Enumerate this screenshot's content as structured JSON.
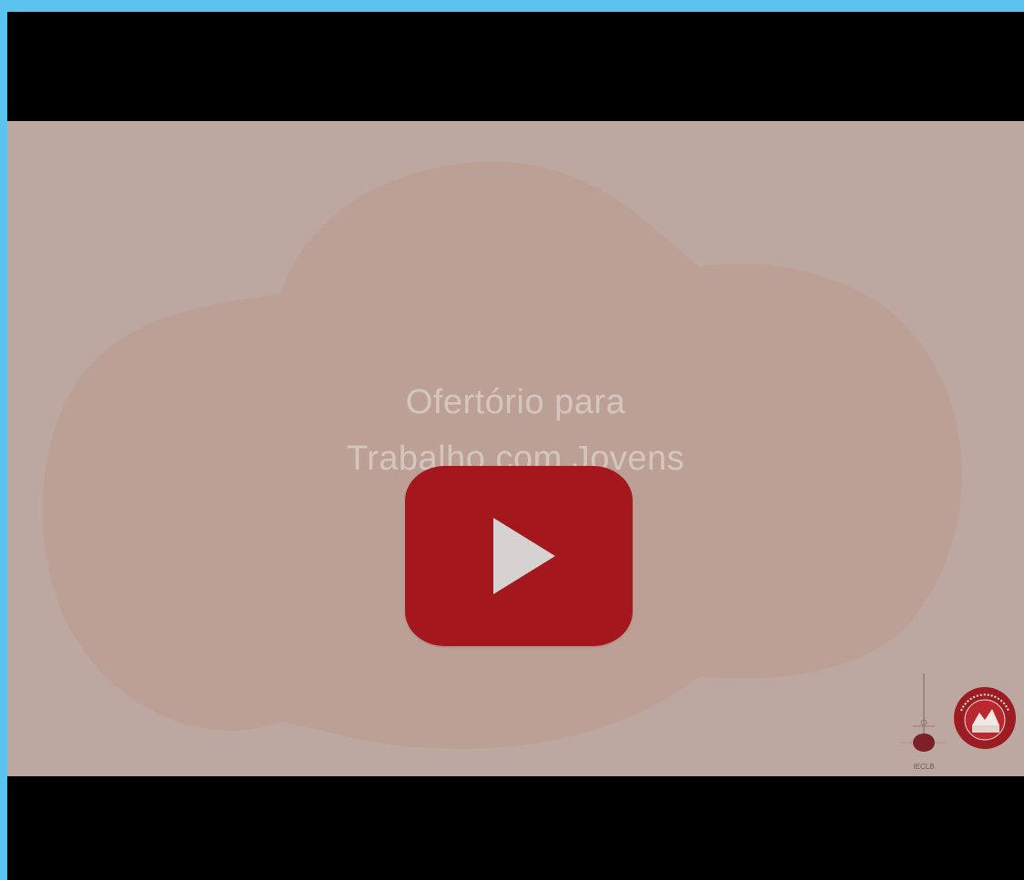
{
  "video": {
    "title_line1": "Ofertório para",
    "title_line2": "Trabalho com Jovens",
    "subtitle": "Juventude Evangélica",
    "play_label": "Play video",
    "colors": {
      "frame": "#5ac3ee",
      "letterbox": "#000000",
      "background": "#bca8a0",
      "blob": "#bd9f94",
      "play_button": "#a4171c",
      "play_icon": "#d7d2d2"
    }
  },
  "logos": {
    "ieclb_label": "IECLB",
    "seal_name": "juventude-evangelica-seal-icon",
    "seal_label": "JUVENTUDE EVANGÉLICA",
    "seal_sub": "IECLB"
  }
}
